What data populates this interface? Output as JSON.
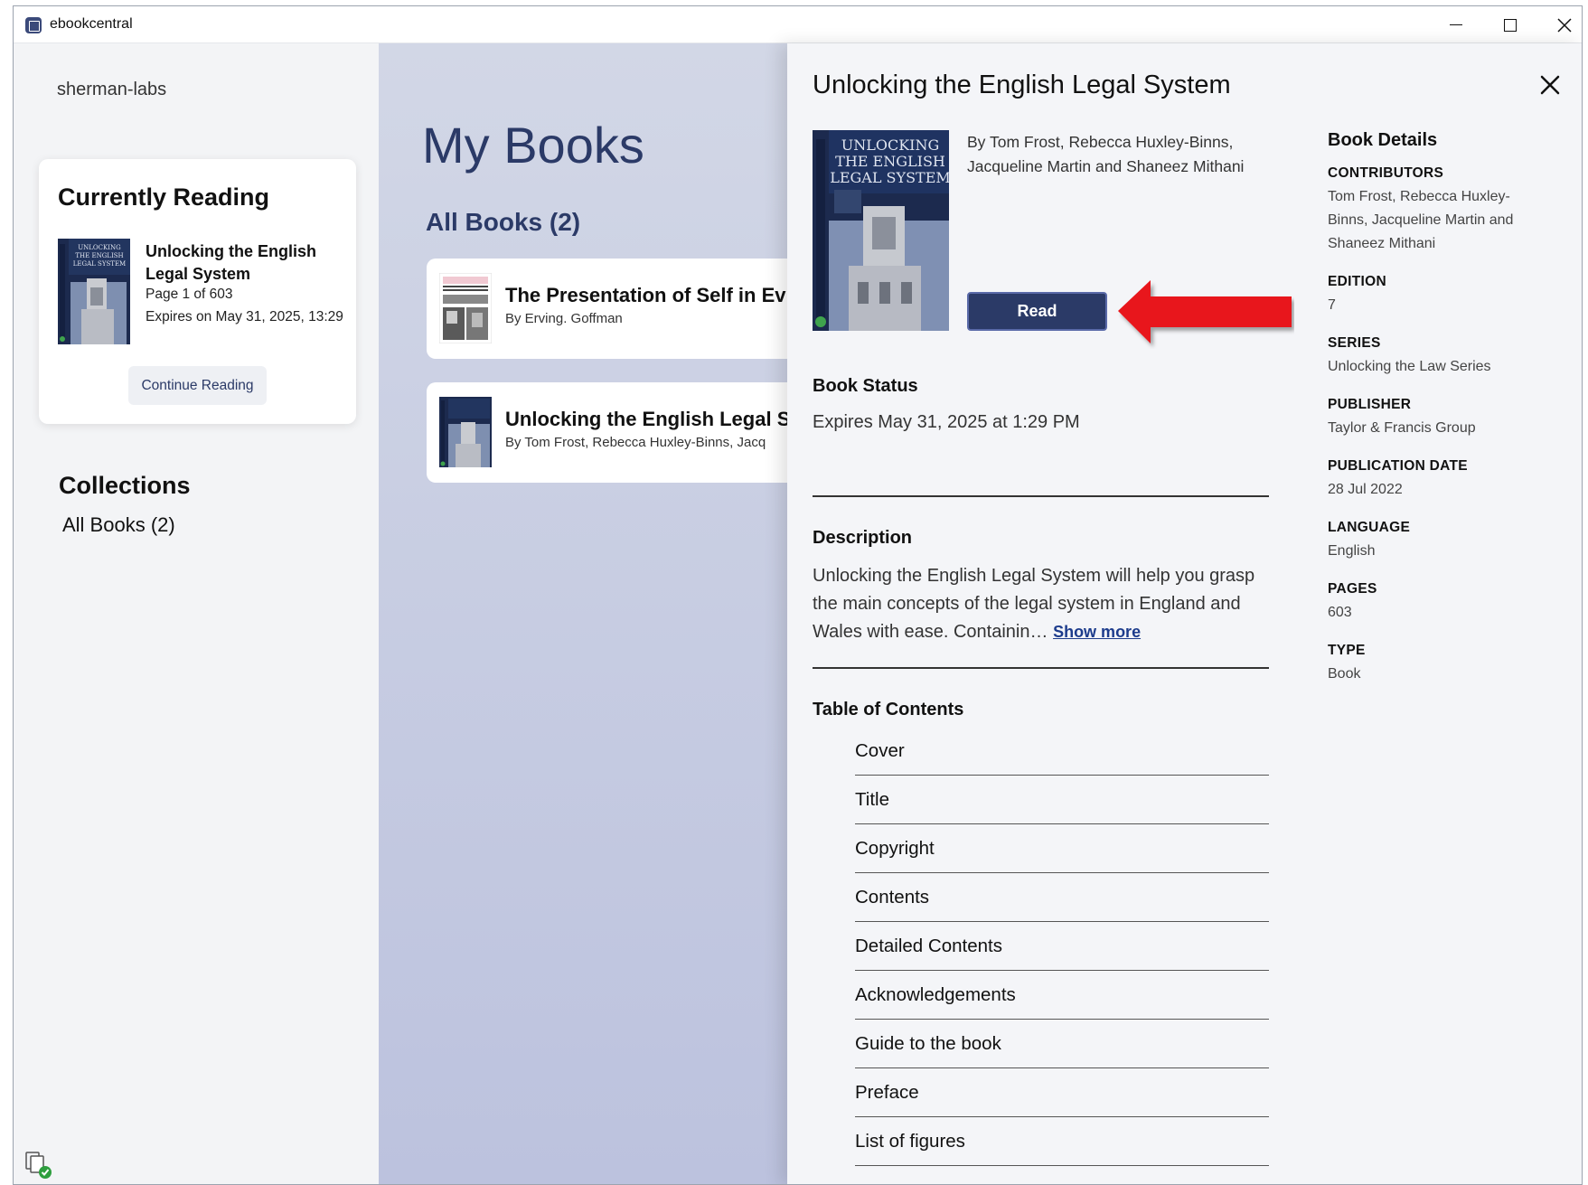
{
  "window": {
    "title": "ebookcentral",
    "controls": {
      "minimize": "minimize-icon",
      "maximize": "maximize-icon",
      "close": "close-icon"
    }
  },
  "sidebar": {
    "account": "sherman-labs",
    "currently_reading": {
      "heading": "Currently Reading",
      "title": "Unlocking the English Legal System",
      "page": "Page 1 of 603",
      "expires": "Expires on May 31, 2025, 13:29",
      "button": "Continue Reading"
    },
    "collections": {
      "heading": "Collections",
      "items": [
        "All Books (2)"
      ]
    }
  },
  "main": {
    "title": "My Books",
    "subtitle": "All Books (2)",
    "books": [
      {
        "title": "The Presentation of Self in Ev",
        "author": "By Erving. Goffman"
      },
      {
        "title": "Unlocking the English Legal S",
        "author": "By Tom Frost, Rebecca Huxley-Binns, Jacq"
      }
    ]
  },
  "detail": {
    "title": "Unlocking the English Legal System",
    "authors": "By Tom Frost, Rebecca Huxley-Binns, Jacqueline Martin and Shaneez Mithani",
    "read_button": "Read",
    "cover_text": {
      "line1": "UNLOCKING",
      "line2": "THE ENGLISH",
      "line3": "LEGAL SYSTEM"
    },
    "status": {
      "heading": "Book Status",
      "value": "Expires May 31, 2025 at 1:29 PM"
    },
    "description": {
      "heading": "Description",
      "text": "Unlocking the English Legal System will help you grasp the main concepts of the legal system in England and Wales with ease. Containin…",
      "show_more": "Show more"
    },
    "toc": {
      "heading": "Table of Contents",
      "items": [
        "Cover",
        "Title",
        "Copyright",
        "Contents",
        "Detailed Contents",
        "Acknowledgements",
        "Guide to the book",
        "Preface",
        "List of figures"
      ]
    },
    "book_details": {
      "heading": "Book Details",
      "contributors_label": "CONTRIBUTORS",
      "contributors": "Tom Frost, Rebecca Huxley-Binns, Jacqueline Martin and Shaneez Mithani",
      "edition_label": "EDITION",
      "edition": "7",
      "series_label": "SERIES",
      "series": "Unlocking the Law Series",
      "publisher_label": "PUBLISHER",
      "publisher": "Taylor & Francis Group",
      "publication_date_label": "PUBLICATION DATE",
      "publication_date": "28 Jul 2022",
      "language_label": "LANGUAGE",
      "language": "English",
      "pages_label": "PAGES",
      "pages": "603",
      "type_label": "TYPE",
      "type": "Book"
    }
  },
  "colors": {
    "accent": "#2b3a67",
    "arrow": "#e8141c",
    "link": "#1d3c8c"
  }
}
